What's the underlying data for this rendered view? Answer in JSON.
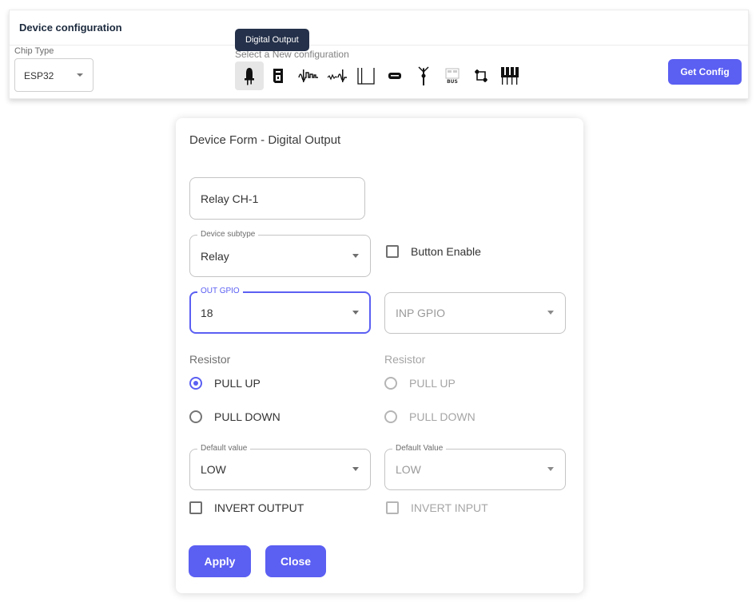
{
  "header": {
    "title": "Device configuration",
    "chip_type_label": "Chip Type",
    "chip_type_value": "ESP32",
    "select_hint": "Select a New configuration",
    "tooltip": "Digital Output",
    "get_config_label": "Get Config",
    "icons": [
      {
        "name": "digital-output-icon",
        "active": true
      },
      {
        "name": "digital-input-icon",
        "active": false
      },
      {
        "name": "pwm-output-icon",
        "active": false
      },
      {
        "name": "analog-input-icon",
        "active": false
      },
      {
        "name": "rgb-strip-icon",
        "active": false
      },
      {
        "name": "display-icon",
        "active": false
      },
      {
        "name": "antenna-icon",
        "active": false
      },
      {
        "name": "bus-icon",
        "active": false
      },
      {
        "name": "i2c-icon",
        "active": false
      },
      {
        "name": "multi-relay-icon",
        "active": false
      }
    ]
  },
  "form": {
    "title": "Device Form - Digital Output",
    "device_name_value": "Relay CH-1",
    "subtype_label": "Device subtype",
    "subtype_value": "Relay",
    "button_enable_label": "Button Enable",
    "out_gpio_label": "OUT GPIO",
    "out_gpio_value": "18",
    "inp_gpio_placeholder": "INP GPIO",
    "resistor_left": {
      "label": "Resistor",
      "options": [
        "PULL UP",
        "PULL DOWN"
      ],
      "selected": "PULL UP"
    },
    "resistor_right": {
      "label": "Resistor",
      "options": [
        "PULL UP",
        "PULL DOWN"
      ]
    },
    "default_value_left_label": "Default value",
    "default_value_left": "LOW",
    "default_value_right_label": "Default Value",
    "default_value_right": "LOW",
    "invert_output_label": "INVERT OUTPUT",
    "invert_input_label": "INVERT INPUT",
    "apply_label": "Apply",
    "close_label": "Close"
  },
  "colors": {
    "accent": "#5b5ff2",
    "tooltip_bg": "#25314a",
    "title_text": "#1c2a3e"
  }
}
